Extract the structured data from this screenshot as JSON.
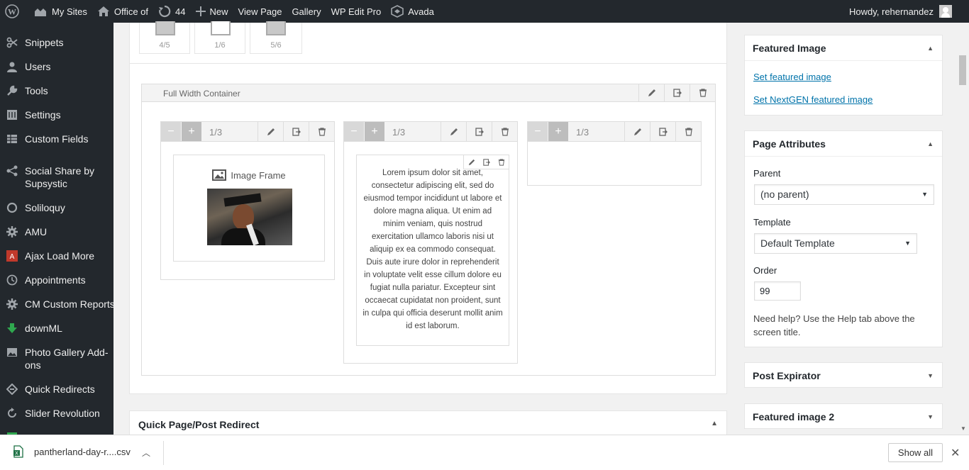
{
  "adminbar": {
    "my_sites": "My Sites",
    "site_name": "Office of",
    "updates_count": "44",
    "new_label": "New",
    "view_page": "View Page",
    "gallery": "Gallery",
    "wp_edit_pro": "WP Edit Pro",
    "avada": "Avada",
    "howdy": "Howdy, rehernandez"
  },
  "menu": {
    "items": [
      {
        "label": "Snippets",
        "icon": "scissors-icon"
      },
      {
        "label": "Users",
        "icon": "user-icon"
      },
      {
        "label": "Tools",
        "icon": "wrench-icon"
      },
      {
        "label": "Settings",
        "icon": "sliders-icon"
      },
      {
        "label": "Custom Fields",
        "icon": "table-icon"
      },
      {
        "label": "Social Share by Supsystic",
        "icon": "share-icon"
      },
      {
        "label": "Soliloquy",
        "icon": "ring-icon"
      },
      {
        "label": "AMU",
        "icon": "gear-icon"
      },
      {
        "label": "Ajax Load More",
        "icon": "alm-logo-icon"
      },
      {
        "label": "Appointments",
        "icon": "clock-icon"
      },
      {
        "label": "CM Custom Reports",
        "icon": "gear-icon"
      },
      {
        "label": "downML",
        "icon": "download-arrow-icon"
      },
      {
        "label": "Photo Gallery Add-ons",
        "icon": "photo-icon"
      },
      {
        "label": "Quick Redirects",
        "icon": "redirect-icon"
      },
      {
        "label": "Slider Revolution",
        "icon": "refresh-icon"
      }
    ]
  },
  "builder": {
    "presets": [
      "4/5",
      "1/6",
      "5/6"
    ],
    "container_title": "Full Width Container",
    "columns": [
      {
        "size": "1/3"
      },
      {
        "size": "1/3"
      },
      {
        "size": "1/3"
      }
    ],
    "image_frame_label": "Image Frame",
    "lorem_text": "Lorem ipsum dolor sit amet, consectetur adipiscing elit, sed do eiusmod tempor incididunt ut labore et dolore magna aliqua. Ut enim ad minim veniam, quis nostrud exercitation ullamco laboris nisi ut aliquip ex ea commodo consequat. Duis aute irure dolor in reprehenderit in voluptate velit esse cillum dolore eu fugiat nulla pariatur. Excepteur sint occaecat cupidatat non proident, sunt in culpa qui officia deserunt mollit anim id est laborum."
  },
  "redirect_box": {
    "title": "Quick Page/Post Redirect"
  },
  "sidebar": {
    "featured_image": {
      "title": "Featured Image",
      "set_link": "Set featured image",
      "set_nextgen_link": "Set NextGEN featured image"
    },
    "page_attributes": {
      "title": "Page Attributes",
      "parent_label": "Parent",
      "parent_value": "(no parent)",
      "template_label": "Template",
      "template_value": "Default Template",
      "order_label": "Order",
      "order_value": "99",
      "help": "Need help? Use the Help tab above the screen title."
    },
    "post_expirator": {
      "title": "Post Expirator"
    },
    "featured_image_2": {
      "title": "Featured image 2"
    }
  },
  "downloads": {
    "file_name": "pantherland-day-r....csv",
    "show_all": "Show all"
  },
  "colors": {
    "adminbar_bg": "#23282d",
    "menu_bg": "#23282d",
    "link": "#0073aa"
  }
}
